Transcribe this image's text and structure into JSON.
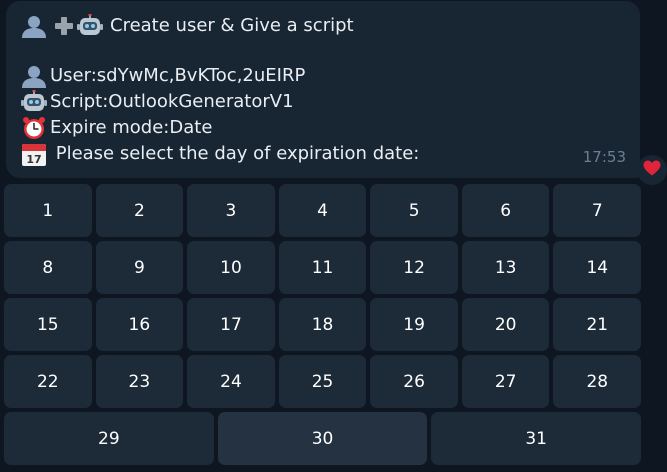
{
  "message": {
    "title": "Create user & Give a script",
    "user_line": "User:sdYwMc,BvKToc,2uEIRP",
    "script_line": "Script:OutlookGeneratorV1",
    "expire_line": "Expire mode:Date",
    "select_line": " Please select the day of expiration date:",
    "time": "17:53",
    "icons": [
      "user-icon",
      "plus-icon",
      "robot-icon",
      "alarm-clock-icon",
      "calendar-icon"
    ],
    "reaction_icon": "heart-icon",
    "reaction_color": "#e0243a"
  },
  "keyboard": {
    "rows": [
      [
        "1",
        "2",
        "3",
        "4",
        "5",
        "6",
        "7"
      ],
      [
        "8",
        "9",
        "10",
        "11",
        "12",
        "13",
        "14"
      ],
      [
        "15",
        "16",
        "17",
        "18",
        "19",
        "20",
        "21"
      ],
      [
        "22",
        "23",
        "24",
        "25",
        "26",
        "27",
        "28"
      ],
      [
        "29",
        "30",
        "31"
      ]
    ]
  },
  "colors": {
    "background": "#0e1621",
    "bubble": "#182533",
    "button": "#1d2a38",
    "button_highlight": "#243242",
    "time": "#6d7f8f"
  }
}
